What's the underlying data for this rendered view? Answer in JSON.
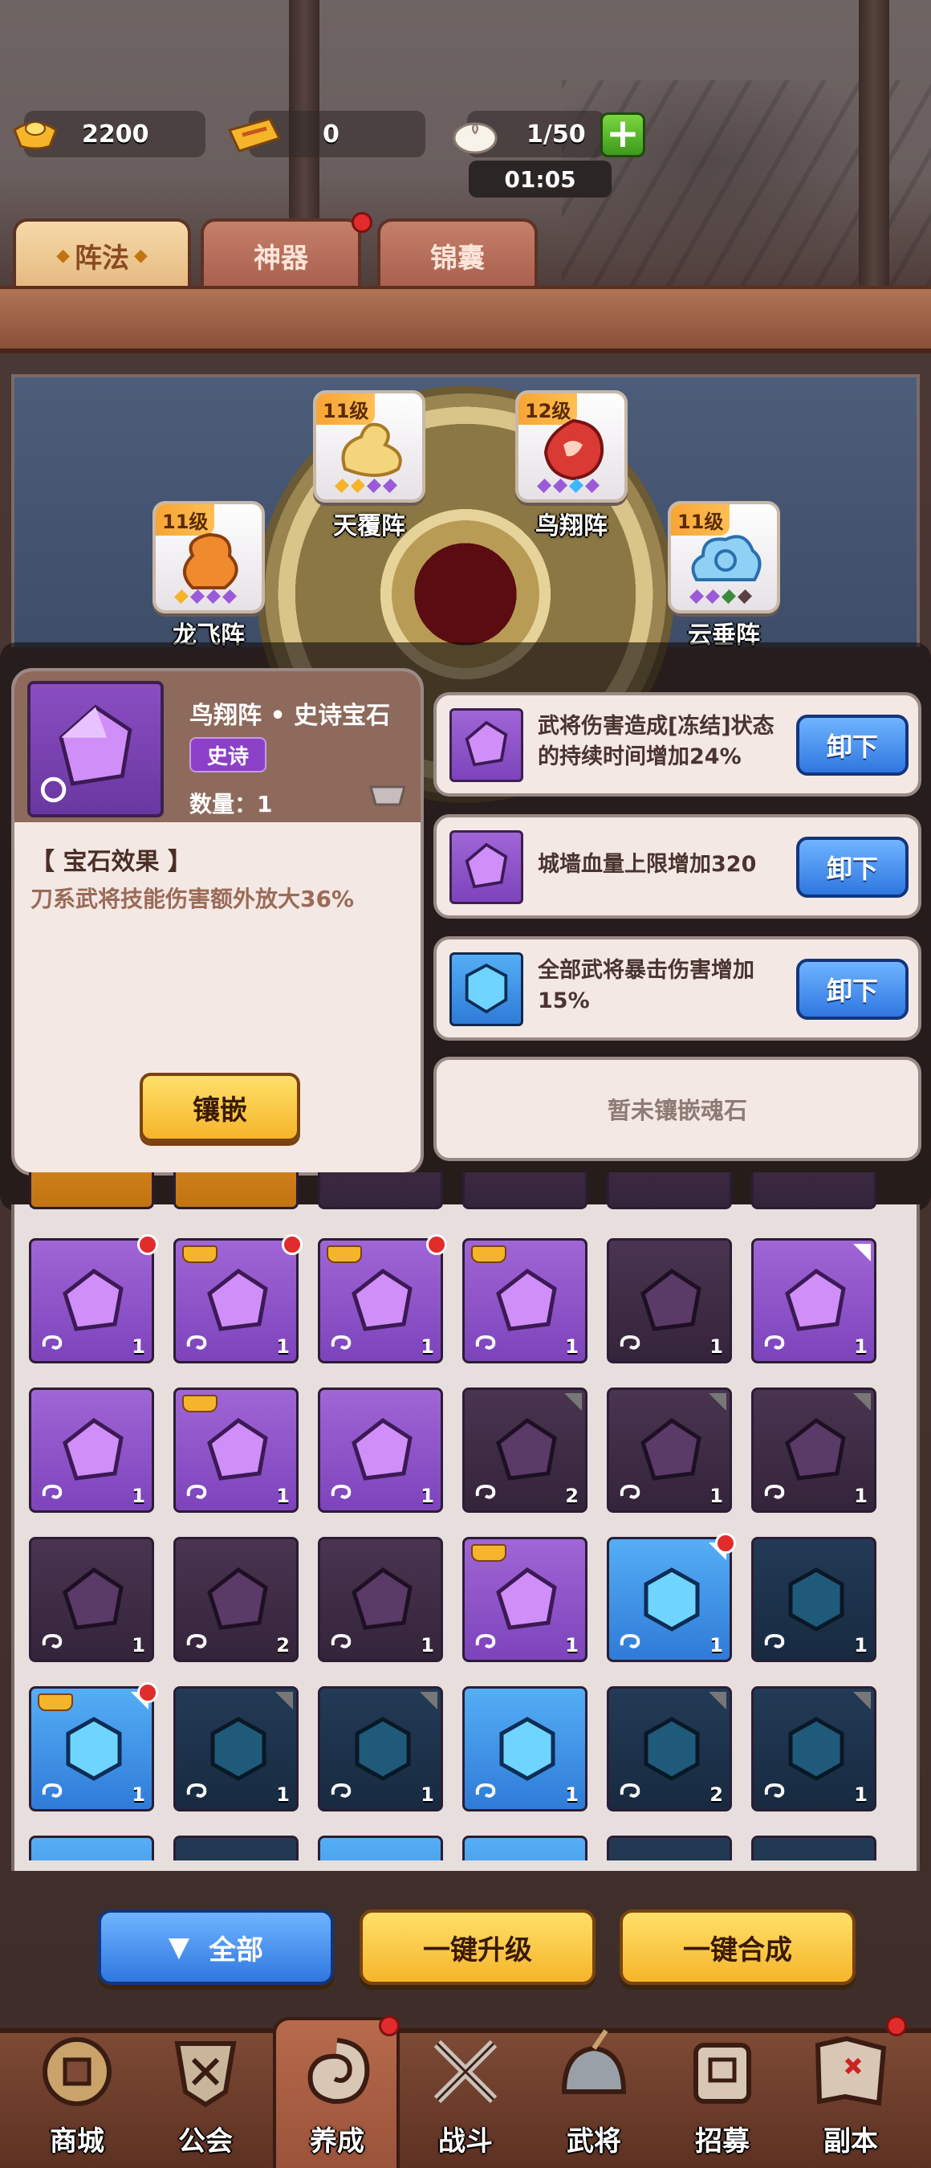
{
  "resources": {
    "gold": "2200",
    "ticket": "0",
    "stamina": "1/50",
    "timer": "01:05"
  },
  "tabs": [
    {
      "label": "阵法",
      "active": true
    },
    {
      "label": "神器",
      "active": false,
      "badge": true
    },
    {
      "label": "锦囊",
      "active": false
    }
  ],
  "formations": [
    {
      "name": "天覆阵",
      "level": "11级",
      "icon": "golden-turtle-icon"
    },
    {
      "name": "鸟翔阵",
      "level": "12级",
      "icon": "red-phoenix-icon"
    },
    {
      "name": "龙飞阵",
      "level": "11级",
      "icon": "orange-dragon-icon"
    },
    {
      "name": "云垂阵",
      "level": "11级",
      "icon": "blue-cloud-icon"
    }
  ],
  "detail": {
    "name": "鸟翔阵 • 史诗宝石",
    "rarity": "史诗",
    "quantity": "数量：1",
    "effect_title": "【 宝石效果 】",
    "effect_text": "刀系武将技能伤害额外放大36%",
    "embed_label": "镶嵌"
  },
  "slots": [
    {
      "desc": "武将伤害造成[冻结]状态的持续时间增加24%",
      "button": "卸下",
      "gem": "purple"
    },
    {
      "desc": "城墙血量上限增加320",
      "button": "卸下",
      "gem": "purple"
    },
    {
      "desc": "全部武将暴击伤害增加15%",
      "button": "卸下",
      "gem": "blue"
    }
  ],
  "empty_slot": "暂未镶嵌魂石",
  "inventory": [
    {
      "color": "purple",
      "count": "1",
      "crown": false,
      "dot": true,
      "corner": ""
    },
    {
      "color": "purple",
      "count": "1",
      "crown": true,
      "dot": true,
      "corner": ""
    },
    {
      "color": "purple",
      "count": "1",
      "crown": true,
      "dot": true,
      "corner": ""
    },
    {
      "color": "purple",
      "count": "1",
      "crown": true,
      "dot": false,
      "corner": ""
    },
    {
      "color": "dpurple",
      "count": "1",
      "crown": false,
      "dot": false,
      "corner": ""
    },
    {
      "color": "purple",
      "count": "1",
      "crown": false,
      "dot": false,
      "corner": "white"
    },
    {
      "color": "purple",
      "count": "1",
      "crown": false,
      "dot": false,
      "corner": ""
    },
    {
      "color": "purple",
      "count": "1",
      "crown": true,
      "dot": false,
      "corner": ""
    },
    {
      "color": "purple",
      "count": "1",
      "crown": false,
      "dot": false,
      "corner": ""
    },
    {
      "color": "dpurple",
      "count": "2",
      "crown": false,
      "dot": false,
      "corner": "dark"
    },
    {
      "color": "dpurple",
      "count": "1",
      "crown": false,
      "dot": false,
      "corner": "dark"
    },
    {
      "color": "dpurple",
      "count": "1",
      "crown": false,
      "dot": false,
      "corner": "dark"
    },
    {
      "color": "dpurple",
      "count": "1",
      "crown": false,
      "dot": false,
      "corner": ""
    },
    {
      "color": "dpurple",
      "count": "2",
      "crown": false,
      "dot": false,
      "corner": ""
    },
    {
      "color": "dpurple",
      "count": "1",
      "crown": false,
      "dot": false,
      "corner": ""
    },
    {
      "color": "purple",
      "count": "1",
      "crown": true,
      "dot": false,
      "corner": ""
    },
    {
      "color": "blue",
      "count": "1",
      "crown": false,
      "dot": true,
      "corner": "white"
    },
    {
      "color": "dblue",
      "count": "1",
      "crown": false,
      "dot": false,
      "corner": ""
    },
    {
      "color": "blue",
      "count": "1",
      "crown": true,
      "dot": true,
      "corner": "white"
    },
    {
      "color": "dblue",
      "count": "1",
      "crown": false,
      "dot": false,
      "corner": "dark"
    },
    {
      "color": "dblue",
      "count": "1",
      "crown": false,
      "dot": false,
      "corner": "dark"
    },
    {
      "color": "blue",
      "count": "1",
      "crown": false,
      "dot": false,
      "corner": ""
    },
    {
      "color": "dblue",
      "count": "2",
      "crown": false,
      "dot": false,
      "corner": "dark"
    },
    {
      "color": "dblue",
      "count": "1",
      "crown": false,
      "dot": false,
      "corner": "dark"
    }
  ],
  "actions": {
    "all": "全部",
    "upgrade": "一键升级",
    "merge": "一键合成"
  },
  "nav": [
    {
      "label": "商城",
      "icon": "coin-shop-icon"
    },
    {
      "label": "公会",
      "icon": "guild-shield-icon"
    },
    {
      "label": "养成",
      "icon": "dragon-swirl-icon",
      "active": true,
      "badge": true
    },
    {
      "label": "战斗",
      "icon": "crossed-swords-icon"
    },
    {
      "label": "武将",
      "icon": "warrior-helmet-icon"
    },
    {
      "label": "招募",
      "icon": "recruit-scroll-icon"
    },
    {
      "label": "副本",
      "icon": "treasure-map-icon",
      "badge": true
    }
  ],
  "colors": {
    "purple_gem": "#b57cf0",
    "blue_gem": "#3fb6ff",
    "badge_red": "#e22b2b",
    "button_yellow": "#f5b52a",
    "button_blue": "#2f77e0"
  }
}
